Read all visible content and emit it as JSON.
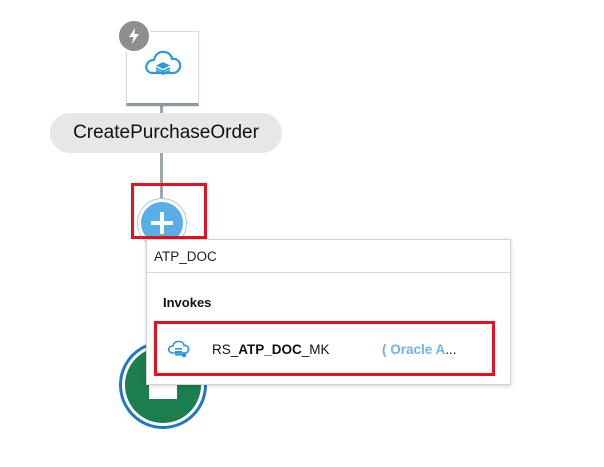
{
  "flow": {
    "trigger_node": {
      "icon": "cloud-adapter-icon",
      "badge_icon": "lightning-bolt-icon",
      "label": "CreatePurchaseOrder"
    },
    "add_action_icon": "plus-icon",
    "end_node_icon": "stop-icon"
  },
  "popup": {
    "search_value": "ATP_DOC",
    "section_title": "Invokes",
    "items": [
      {
        "icon": "rest-adapter-icon",
        "name_prefix": "RS_",
        "name_match": "ATP_DOC",
        "name_suffix": "_MK",
        "type_label": "( Oracle A",
        "type_ellipsis": "..."
      }
    ]
  },
  "colors": {
    "highlight": "#e3121f",
    "add_button": "#5aaee8",
    "end_ring": "#1e78c2",
    "end_fill": "#1c7d4e",
    "type_text": "#6fb3e6"
  }
}
